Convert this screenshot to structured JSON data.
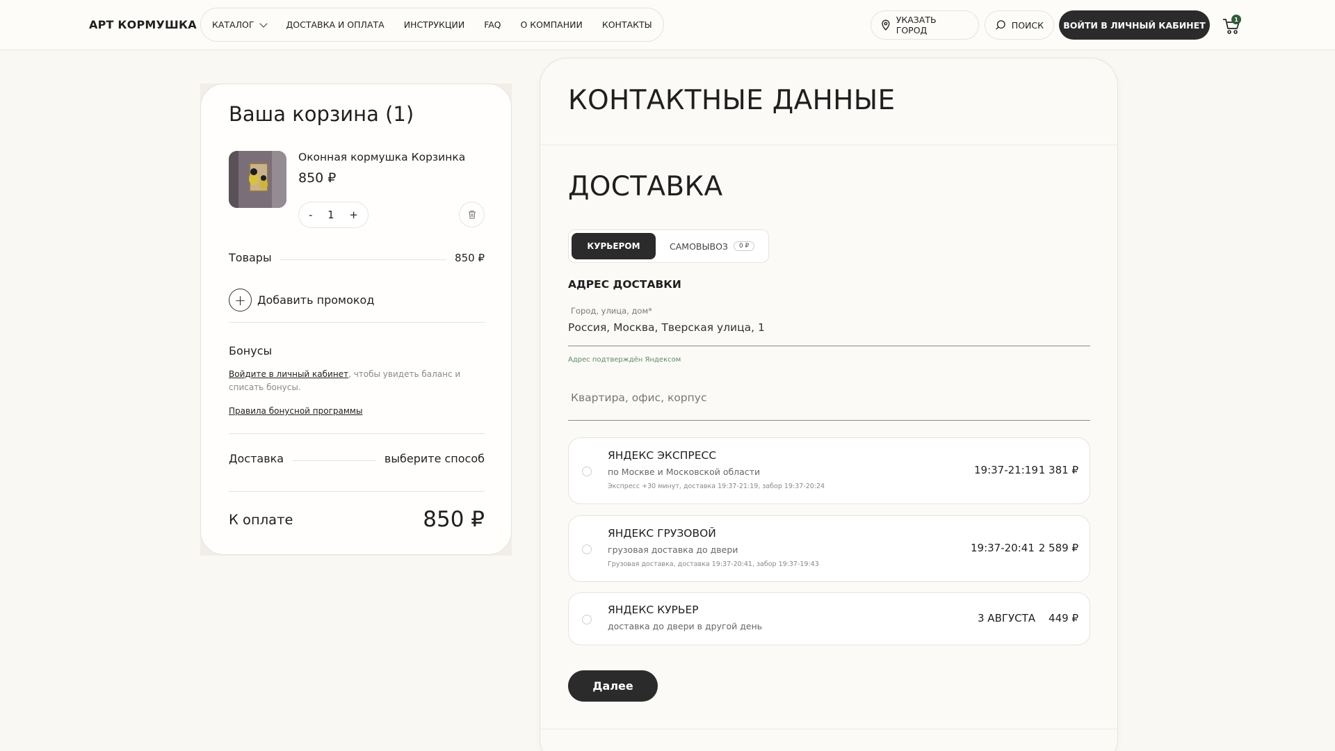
{
  "header": {
    "logo": "АРТ КОРМУШКА",
    "nav": [
      "КАТАЛОГ",
      "ДОСТАВКА И ОПЛАТА",
      "ИНСТРУКЦИИ",
      "FAQ",
      "О КОМПАНИИ",
      "КОНТАКТЫ"
    ],
    "city_label": "УКАЗАТЬ ГОРОД",
    "search_label": "ПОИСК",
    "login_label": "ВОЙТИ В ЛИЧНЫЙ КАБИНЕТ",
    "cart_count": "1"
  },
  "cart": {
    "title": "Ваша корзина (1)",
    "item": {
      "name": "Оконная кормушка Корзинка",
      "price": "850 ₽",
      "qty": "1"
    },
    "minus": "-",
    "plus": "+",
    "goods_label": "Товары",
    "goods_value": "850 ₽",
    "promo_label": "Добавить промокод",
    "bonus_title": "Бонусы",
    "bonus_link": "Войдите в личный кабинет",
    "bonus_text": ", чтобы увидеть баланс и списать бонусы.",
    "bonus_rules": "Правила бонусной программы",
    "delivery_label": "Доставка",
    "delivery_value": "выберите способ",
    "total_label": "К оплате",
    "total_value": "850 ₽"
  },
  "main": {
    "contact_title": "КОНТАКТНЫЕ ДАННЫЕ",
    "delivery_title": "ДОСТАВКА",
    "tabs": {
      "active": "КУРЬЕРОМ",
      "other": "САМОВЫВОЗ",
      "other_badge": "0 ₽"
    },
    "address_title": "АДРЕС ДОСТАВКИ",
    "address_label": "Город, улица, дом*",
    "address_value": "Россия, Москва, Тверская улица, 1",
    "address_note": "Адрес подтверждён Яндексом",
    "apartment_placeholder": "Квартира, офис, корпус",
    "options": [
      {
        "title": "ЯНДЕКС ЭКСПРЕСС",
        "subtitle": "по Москве и Московской области",
        "details": "Экспресс +30 минут, доставка 19:37-21:19, забор 19:37-20:24",
        "time": "19:37-21:19",
        "price": "1 381 ₽"
      },
      {
        "title": "ЯНДЕКС ГРУЗОВОЙ",
        "subtitle": "грузовая доставка до двери",
        "details": "Грузовая доставка, доставка 19:37-20:41, забор 19:37-19:43",
        "time": "19:37-20:41",
        "price": "2 589 ₽"
      },
      {
        "title": "ЯНДЕКС КУРЬЕР",
        "subtitle": "доставка до двери в другой день",
        "details": "",
        "time": "3 АВГУСТА",
        "price": "449 ₽"
      }
    ],
    "next_label": "Далее"
  },
  "colors": {
    "accent_dark": "#2b2b2b",
    "background": "#faf8f3",
    "badge_green": "#2f5d3a",
    "note_green": "#5e8a60"
  }
}
